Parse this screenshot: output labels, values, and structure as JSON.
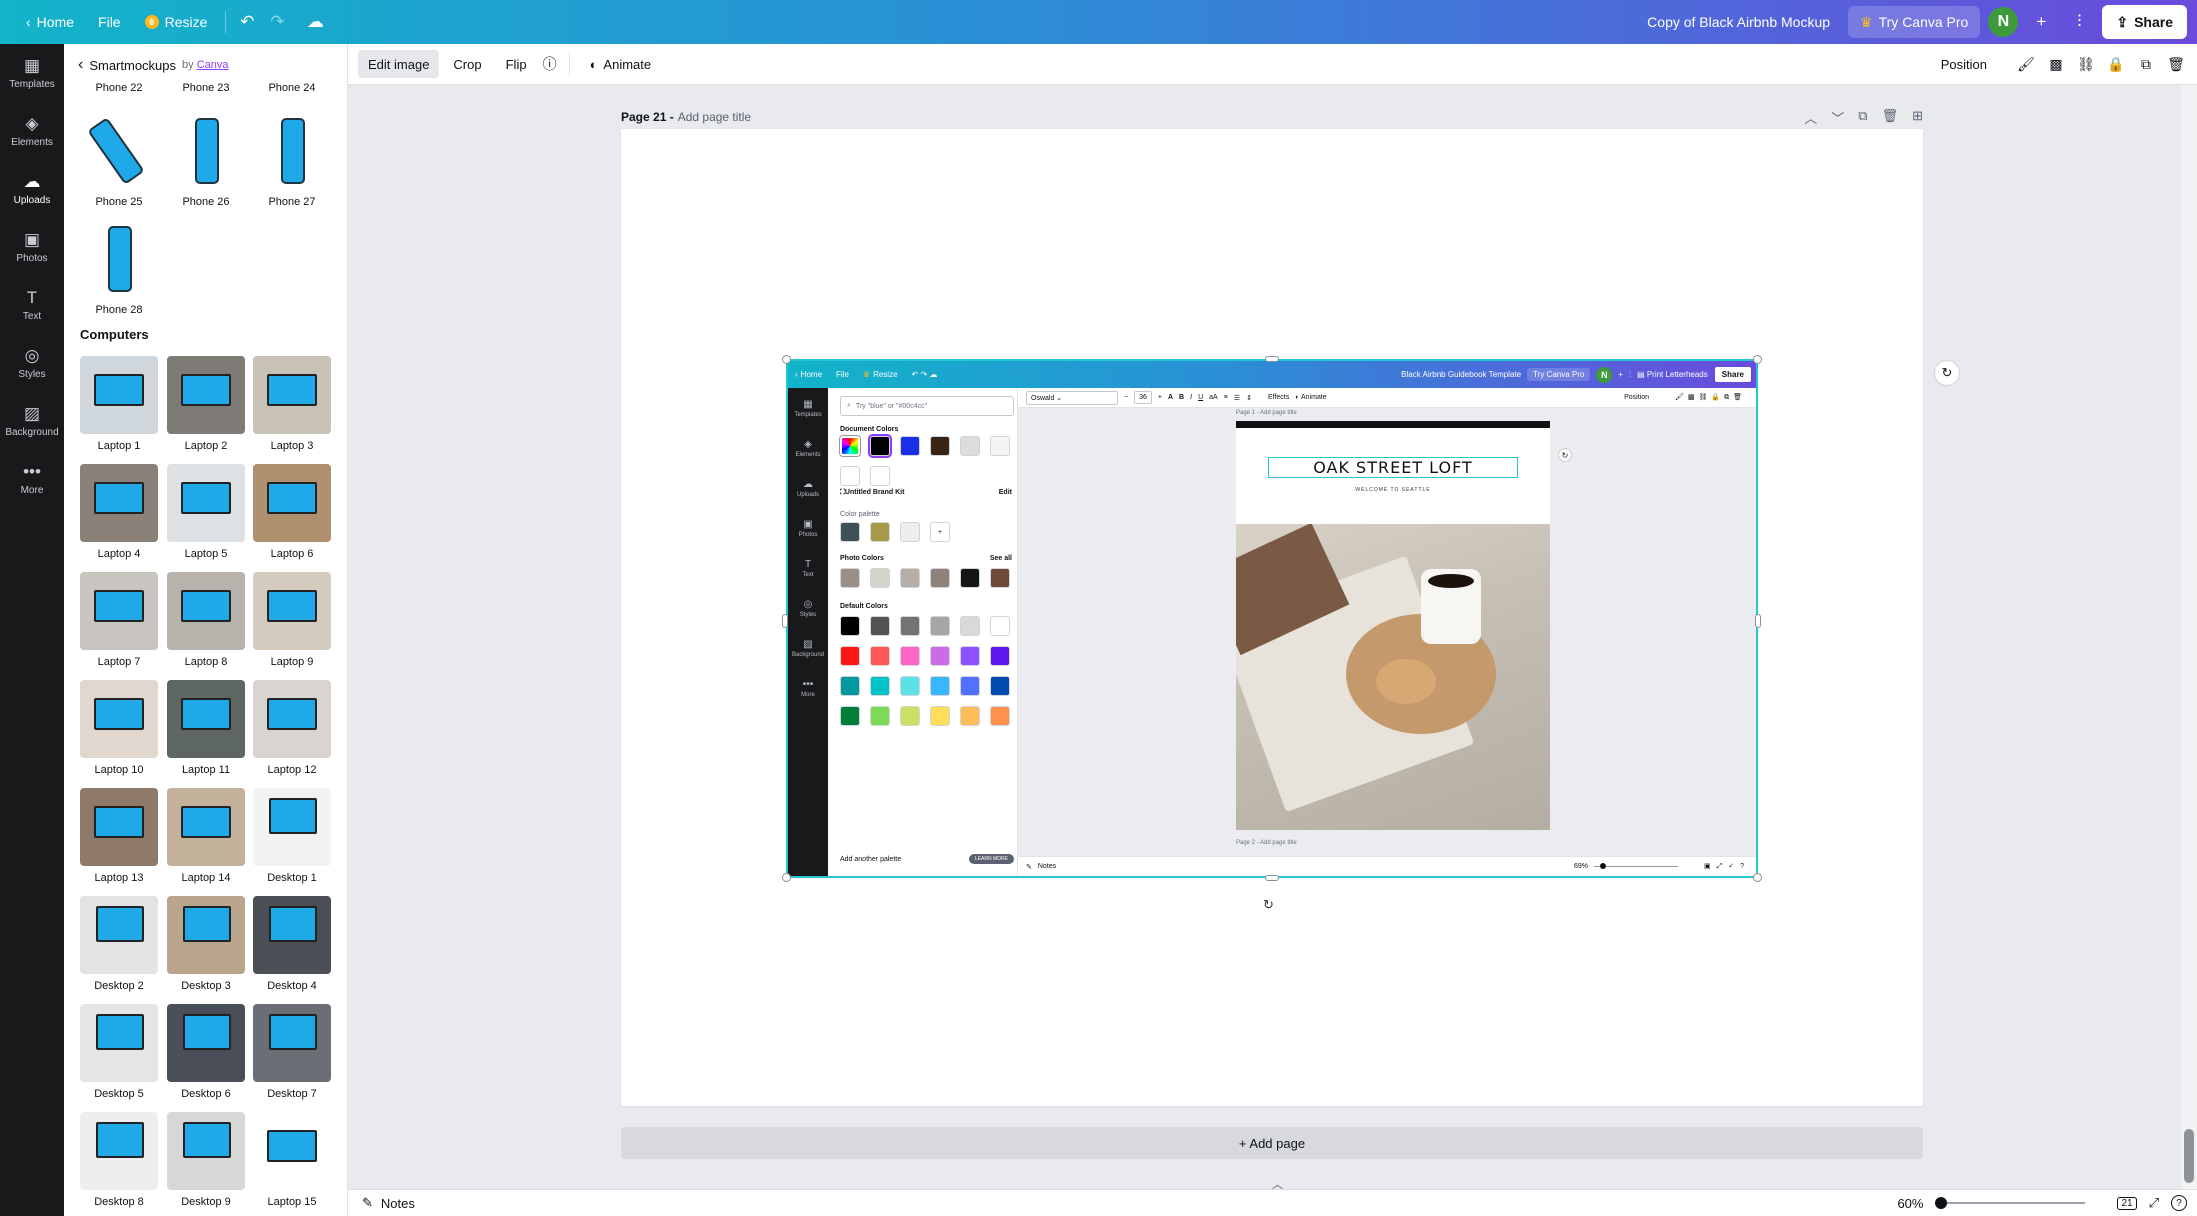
{
  "topbar": {
    "home": "Home",
    "file": "File",
    "resize": "Resize",
    "doc_title": "Copy of Black Airbnb Mockup",
    "try_pro": "Try Canva Pro",
    "avatar": "N",
    "share": "Share"
  },
  "rail": [
    {
      "label": "Templates",
      "icon": "templates-icon",
      "glyph": "▦"
    },
    {
      "label": "Elements",
      "icon": "elements-icon",
      "glyph": "◈"
    },
    {
      "label": "Uploads",
      "icon": "uploads-icon",
      "glyph": "☁"
    },
    {
      "label": "Photos",
      "icon": "photos-icon",
      "glyph": "▣"
    },
    {
      "label": "Text",
      "icon": "text-icon",
      "glyph": "T"
    },
    {
      "label": "Styles",
      "icon": "styles-icon",
      "glyph": "◎"
    },
    {
      "label": "Background",
      "icon": "background-icon",
      "glyph": "▨"
    },
    {
      "label": "More",
      "icon": "more-icon",
      "glyph": "•••"
    }
  ],
  "panel": {
    "title": "Smartmockups",
    "by": "by",
    "by_link": "Canva",
    "top_labels": [
      "Phone 22",
      "Phone 23",
      "Phone 24"
    ],
    "phones": [
      "Phone 25",
      "Phone 26",
      "Phone 27",
      "Phone 28"
    ],
    "section": "Computers",
    "computers": [
      "Laptop 1",
      "Laptop 2",
      "Laptop 3",
      "Laptop 4",
      "Laptop 5",
      "Laptop 6",
      "Laptop 7",
      "Laptop 8",
      "Laptop 9",
      "Laptop 10",
      "Laptop 11",
      "Laptop 12",
      "Laptop 13",
      "Laptop 14",
      "Desktop 1",
      "Desktop 2",
      "Desktop 3",
      "Desktop 4",
      "Desktop 5",
      "Desktop 6",
      "Desktop 7",
      "Desktop 8",
      "Desktop 9",
      "Laptop 15"
    ]
  },
  "context": {
    "edit_image": "Edit image",
    "crop": "Crop",
    "flip": "Flip",
    "animate": "Animate",
    "position": "Position"
  },
  "page": {
    "number": "Page 21 -",
    "title_placeholder": "Add page title",
    "add_page": "+ Add page"
  },
  "bottombar": {
    "notes": "Notes",
    "zoom": "60%",
    "page_count": "21"
  },
  "shot": {
    "home": "Home",
    "file": "File",
    "resize": "Resize",
    "doc_title": "Black Airbnb Guidebook Template",
    "try_pro": "Try Canva Pro",
    "avatar": "N",
    "print": "Print Letterheads",
    "share": "Share",
    "rail": [
      "Templates",
      "Elements",
      "Uploads",
      "Photos",
      "Text",
      "Styles",
      "Background",
      "More"
    ],
    "search_placeholder": "Try \"blue\" or \"#00c4cc\"",
    "document_colors": "Document Colors",
    "brand_kit": "Untitled Brand Kit",
    "edit": "Edit",
    "color_palette": "Color palette",
    "photo_colors": "Photo Colors",
    "see_all": "See all",
    "default_colors": "Default Colors",
    "add_palette": "Add another palette",
    "learn_more": "LEARN MORE",
    "font": "Oswald",
    "font_size": "36",
    "effects": "Effects",
    "animate": "Animate",
    "position": "Position",
    "page1": "Page 1 - Add page title",
    "page2": "Page 2 - Add page title",
    "heading": "OAK STREET LOFT",
    "subheading": "WELCOME TO SEATTLE",
    "notes": "Notes",
    "zoom": "69%",
    "doc_swatches": [
      "#ffffff",
      "#000000",
      "#1a2fe8",
      "#3a2414",
      "#dcdcdc",
      "#f4f4f4",
      "#ffffff",
      "#ffffff"
    ],
    "palette_swatches": [
      "#3d4f57",
      "#a89a4c",
      "#eeeeee"
    ],
    "photo_swatches": [
      "#9a8f86",
      "#d6d2cc",
      "#b6afa8",
      "#8d837b",
      "#151515",
      "#6e4a3a"
    ],
    "default_swatches": [
      "#000000",
      "#545454",
      "#737373",
      "#a6a6a6",
      "#d9d9d9",
      "#ffffff",
      "#ff1616",
      "#ff5757",
      "#ff66c4",
      "#cb6ce6",
      "#8c52ff",
      "#5e17eb",
      "#03989e",
      "#00c2cb",
      "#5ce1e6",
      "#38b6ff",
      "#5271ff",
      "#004aad",
      "#008037",
      "#7ed957",
      "#c9e265",
      "#ffde59",
      "#ffbd59",
      "#ff914d"
    ]
  }
}
